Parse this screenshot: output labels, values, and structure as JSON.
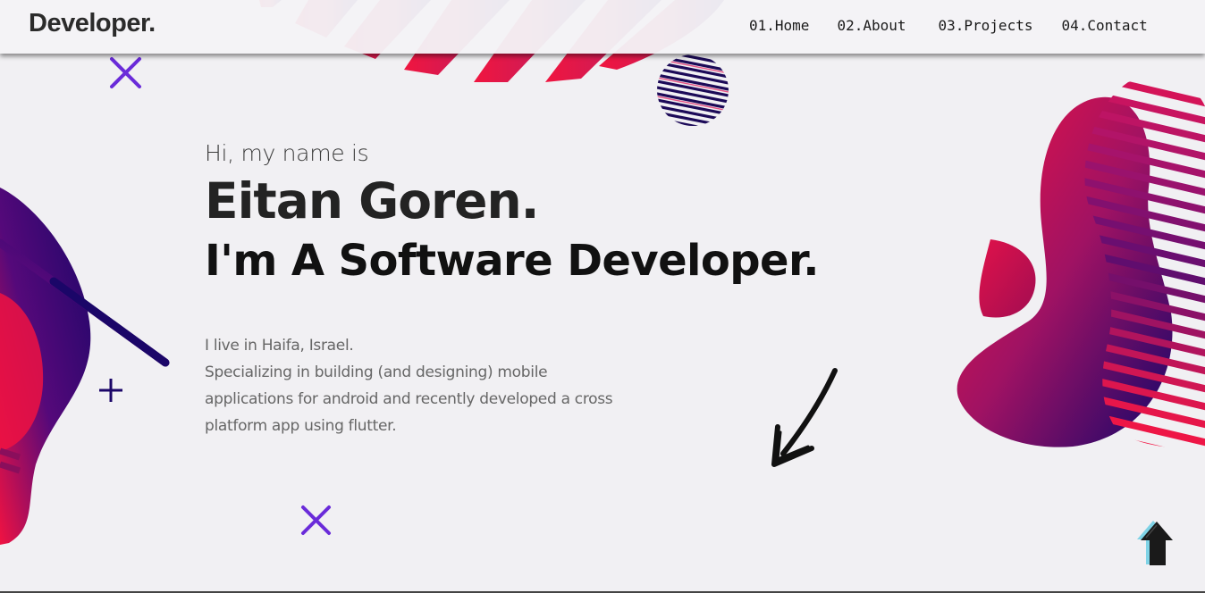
{
  "header": {
    "brand": "Developer.",
    "nav": [
      {
        "label": "01.Home"
      },
      {
        "label": "02.About"
      },
      {
        "label": "03.Projects"
      },
      {
        "label": "04.Contact"
      }
    ]
  },
  "hero": {
    "greeting": "Hi, my name is",
    "name": "Eitan Goren.",
    "role": "I'm A Software Developer.",
    "bio": [
      "I live in Haifa, Israel.",
      "Specializing in building (and designing) mobile",
      "applications for android and recently developed a cross",
      "platform app using flutter."
    ]
  },
  "icons": {
    "scroll_down": "arrow-down-left-icon",
    "back_to_top": "arrow-up-icon"
  },
  "colors": {
    "background": "#f1f0f3",
    "accent_pink": "#f01242",
    "accent_purple": "#1b0668",
    "accent_violet": "#6a2bd9"
  }
}
